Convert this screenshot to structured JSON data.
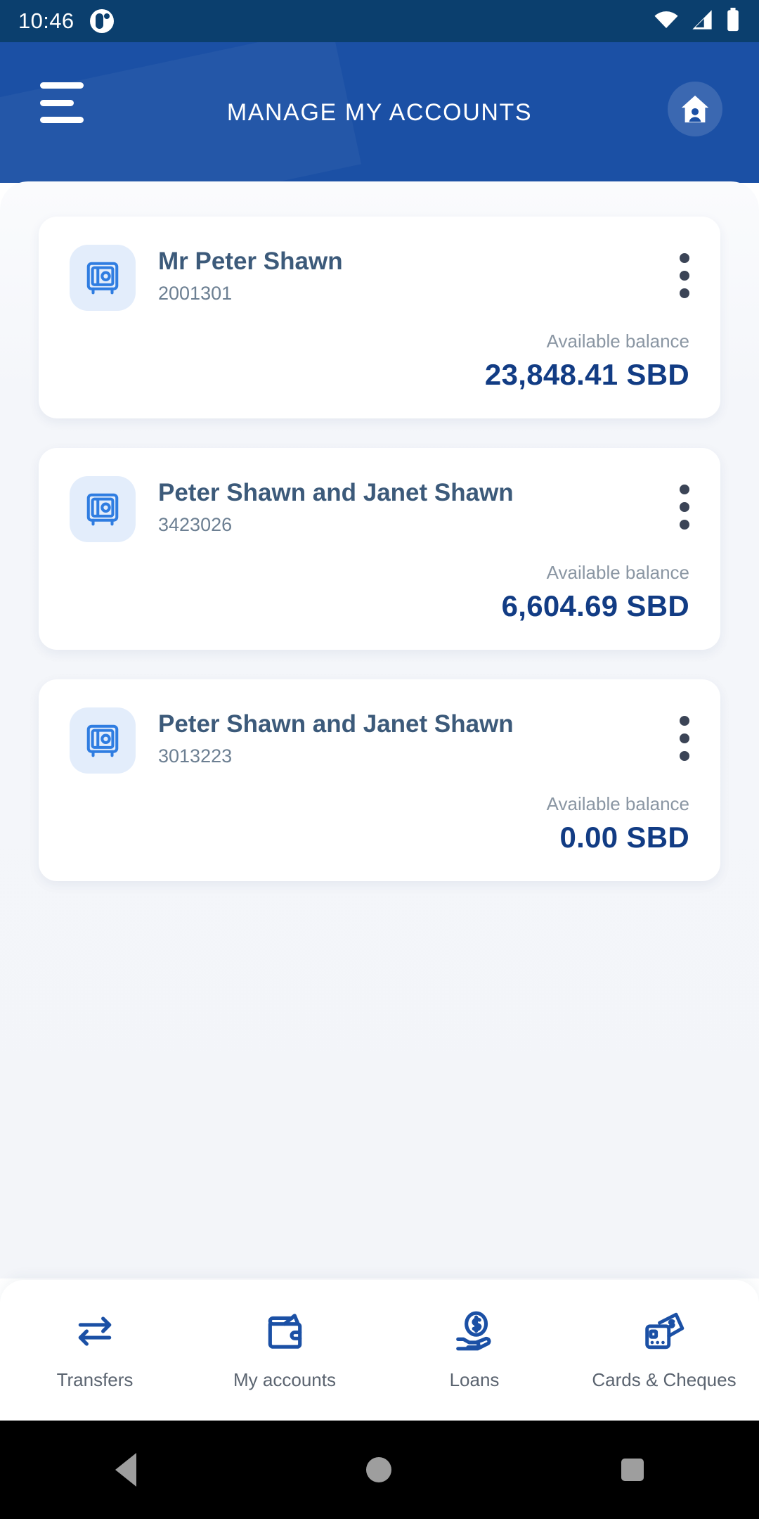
{
  "status_bar": {
    "time": "10:46",
    "app_icon": "app-notification-icon",
    "wifi_icon": "wifi-icon",
    "signal_icon": "cellular-signal-icon",
    "battery_icon": "battery-full-icon"
  },
  "app_bar": {
    "title": "MANAGE MY ACCOUNTS",
    "menu_icon": "hamburger-menu-icon",
    "home_icon": "home-user-icon",
    "background_color": "#1b50a5"
  },
  "theme": {
    "primary_blue": "#1b50a5",
    "dark_blue": "#123c84",
    "status_bar_blue": "#0b3f6e",
    "name_color": "#3c5a7a",
    "muted_color": "#8a96a3"
  },
  "accounts": [
    {
      "icon": "safe-vault-icon",
      "name": "Mr Peter Shawn",
      "number": "2001301",
      "balance_label": "Available balance",
      "balance_value": "23,848.41 SBD",
      "menu_icon": "more-vertical-icon"
    },
    {
      "icon": "safe-vault-icon",
      "name": "Peter Shawn and Janet Shawn",
      "number": "3423026",
      "balance_label": "Available balance",
      "balance_value": "6,604.69 SBD",
      "menu_icon": "more-vertical-icon"
    },
    {
      "icon": "safe-vault-icon",
      "name": "Peter Shawn and Janet Shawn",
      "number": "3013223",
      "balance_label": "Available balance",
      "balance_value": "0.00 SBD",
      "menu_icon": "more-vertical-icon"
    }
  ],
  "bottom_nav": [
    {
      "label": "Transfers",
      "icon": "transfer-arrows-icon"
    },
    {
      "label": "My accounts",
      "icon": "wallet-icon"
    },
    {
      "label": "Loans",
      "icon": "hand-coin-dollar-icon"
    },
    {
      "label": "Cards & Cheques",
      "icon": "cards-cheques-icon"
    }
  ],
  "android_nav": {
    "back": "back-triangle-icon",
    "home": "home-circle-icon",
    "recents": "recents-square-icon"
  }
}
